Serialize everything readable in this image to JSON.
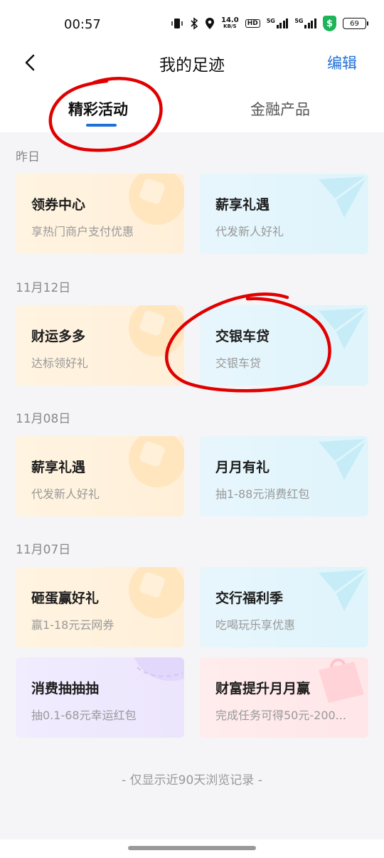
{
  "status_bar": {
    "time": "00:57",
    "net_speed_value": "14.0",
    "net_speed_unit": "KB/S",
    "hd_label": "HD",
    "signal1_label": "5G",
    "signal2_label": "5G",
    "battery": "69",
    "shield_label": "$"
  },
  "header": {
    "title": "我的足迹",
    "edit_label": "编辑"
  },
  "tabs": [
    {
      "label": "精彩活动",
      "active": true
    },
    {
      "label": "金融产品",
      "active": false
    }
  ],
  "groups": [
    {
      "date": "昨日",
      "cards": [
        {
          "title": "领券中心",
          "subtitle": "享热门商户支付优惠",
          "theme": "orange"
        },
        {
          "title": "薪享礼遇",
          "subtitle": "代发新人好礼",
          "theme": "blue"
        }
      ]
    },
    {
      "date": "11月12日",
      "cards": [
        {
          "title": "财运多多",
          "subtitle": "达标领好礼",
          "theme": "orange"
        },
        {
          "title": "交银车贷",
          "subtitle": "交银车贷",
          "theme": "blue"
        }
      ]
    },
    {
      "date": "11月08日",
      "cards": [
        {
          "title": "薪享礼遇",
          "subtitle": "代发新人好礼",
          "theme": "orange"
        },
        {
          "title": "月月有礼",
          "subtitle": "抽1-88元消费红包",
          "theme": "blue"
        }
      ]
    },
    {
      "date": "11月07日",
      "cards": [
        {
          "title": "砸蛋赢好礼",
          "subtitle": "赢1-18元云网券",
          "theme": "orange"
        },
        {
          "title": "交行福利季",
          "subtitle": "吃喝玩乐享优惠",
          "theme": "blue"
        },
        {
          "title": "消费抽抽抽",
          "subtitle": "抽0.1-68元幸运红包",
          "theme": "purple"
        },
        {
          "title": "财富提升月月赢",
          "subtitle": "完成任务可得50元-200...",
          "theme": "pink"
        }
      ]
    }
  ],
  "footer": {
    "note": "- 仅显示近90天浏览记录 -"
  },
  "colors": {
    "accent": "#1f6fd8",
    "annotation": "#e00000"
  }
}
